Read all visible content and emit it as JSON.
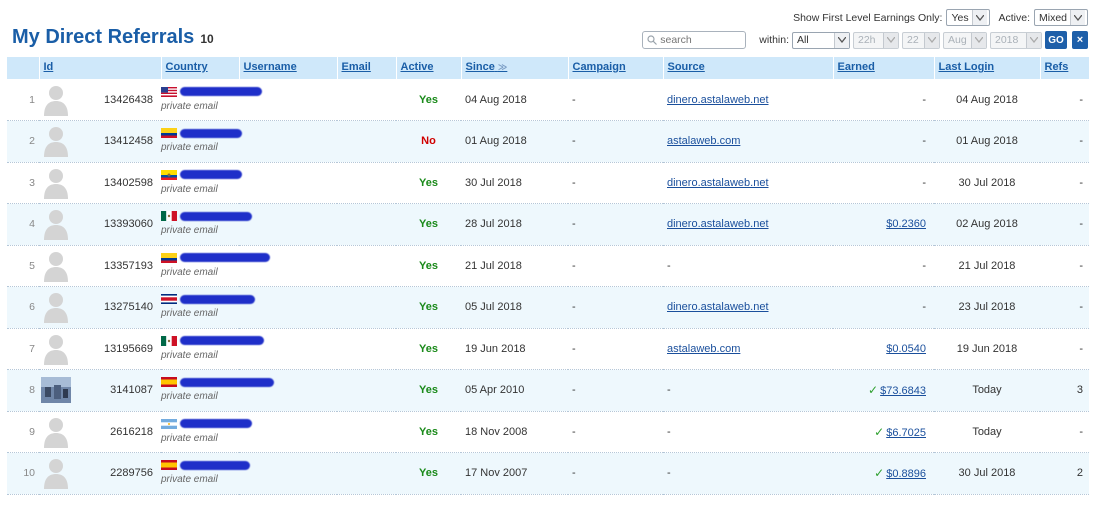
{
  "top": {
    "fle_label": "Show First Level Earnings Only:",
    "fle_value": "Yes",
    "active_label": "Active:",
    "active_value": "Mixed"
  },
  "title": "My Direct Referrals",
  "count": "10",
  "filters": {
    "search_placeholder": "search",
    "within_label": "within:",
    "within_value": "All",
    "day": "22h",
    "date": "22",
    "month": "Aug",
    "year": "2018",
    "go_label": "GO",
    "close_label": "×"
  },
  "columns": {
    "id": "Id",
    "country": "Country",
    "username": "Username",
    "email": "Email",
    "active": "Active",
    "since": "Since",
    "campaign": "Campaign",
    "source": "Source",
    "earned": "Earned",
    "last_login": "Last Login",
    "refs": "Refs"
  },
  "rows": [
    {
      "n": "1",
      "id": "13426438",
      "flag": "us",
      "email": "private email",
      "active": "Yes",
      "since": "04 Aug 2018",
      "campaign": "-",
      "source": "dinero.astalaweb.net",
      "earned": "-",
      "last_login": "04 Aug 2018",
      "refs": "-"
    },
    {
      "n": "2",
      "id": "13412458",
      "flag": "co",
      "email": "private email",
      "active": "No",
      "since": "01 Aug 2018",
      "campaign": "-",
      "source": "astalaweb.com",
      "earned": "-",
      "last_login": "01 Aug 2018",
      "refs": "-"
    },
    {
      "n": "3",
      "id": "13402598",
      "flag": "ec",
      "email": "private email",
      "active": "Yes",
      "since": "30 Jul 2018",
      "campaign": "-",
      "source": "dinero.astalaweb.net",
      "earned": "-",
      "last_login": "30 Jul 2018",
      "refs": "-"
    },
    {
      "n": "4",
      "id": "13393060",
      "flag": "mx",
      "email": "private email",
      "active": "Yes",
      "since": "28 Jul 2018",
      "campaign": "-",
      "source": "dinero.astalaweb.net",
      "earned": "$0.2360",
      "last_login": "02 Aug 2018",
      "refs": "-"
    },
    {
      "n": "5",
      "id": "13357193",
      "flag": "co",
      "email": "private email",
      "active": "Yes",
      "since": "21 Jul 2018",
      "campaign": "-",
      "source": "-",
      "earned": "-",
      "last_login": "21 Jul 2018",
      "refs": "-"
    },
    {
      "n": "6",
      "id": "13275140",
      "flag": "cr",
      "email": "private email",
      "active": "Yes",
      "since": "05 Jul 2018",
      "campaign": "-",
      "source": "dinero.astalaweb.net",
      "earned": "-",
      "last_login": "23 Jul 2018",
      "refs": "-"
    },
    {
      "n": "7",
      "id": "13195669",
      "flag": "mx",
      "email": "private email",
      "active": "Yes",
      "since": "19 Jun 2018",
      "campaign": "-",
      "source": "astalaweb.com",
      "earned": "$0.0540",
      "last_login": "19 Jun 2018",
      "refs": "-"
    },
    {
      "n": "8",
      "id": "3141087",
      "flag": "es",
      "email": "private email",
      "active": "Yes",
      "since": "05 Apr 2010",
      "campaign": "-",
      "source": "-",
      "earned": "$73.6843",
      "last_login": "Today",
      "refs": "3"
    },
    {
      "n": "9",
      "id": "2616218",
      "flag": "ar",
      "email": "private email",
      "active": "Yes",
      "since": "18 Nov 2008",
      "campaign": "-",
      "source": "-",
      "earned": "$6.7025",
      "last_login": "Today",
      "refs": "-"
    },
    {
      "n": "10",
      "id": "2289756",
      "flag": "es",
      "email": "private email",
      "active": "Yes",
      "since": "17 Nov 2007",
      "campaign": "-",
      "source": "-",
      "earned": "$0.8896",
      "last_login": "30 Jul 2018",
      "refs": "2"
    }
  ]
}
